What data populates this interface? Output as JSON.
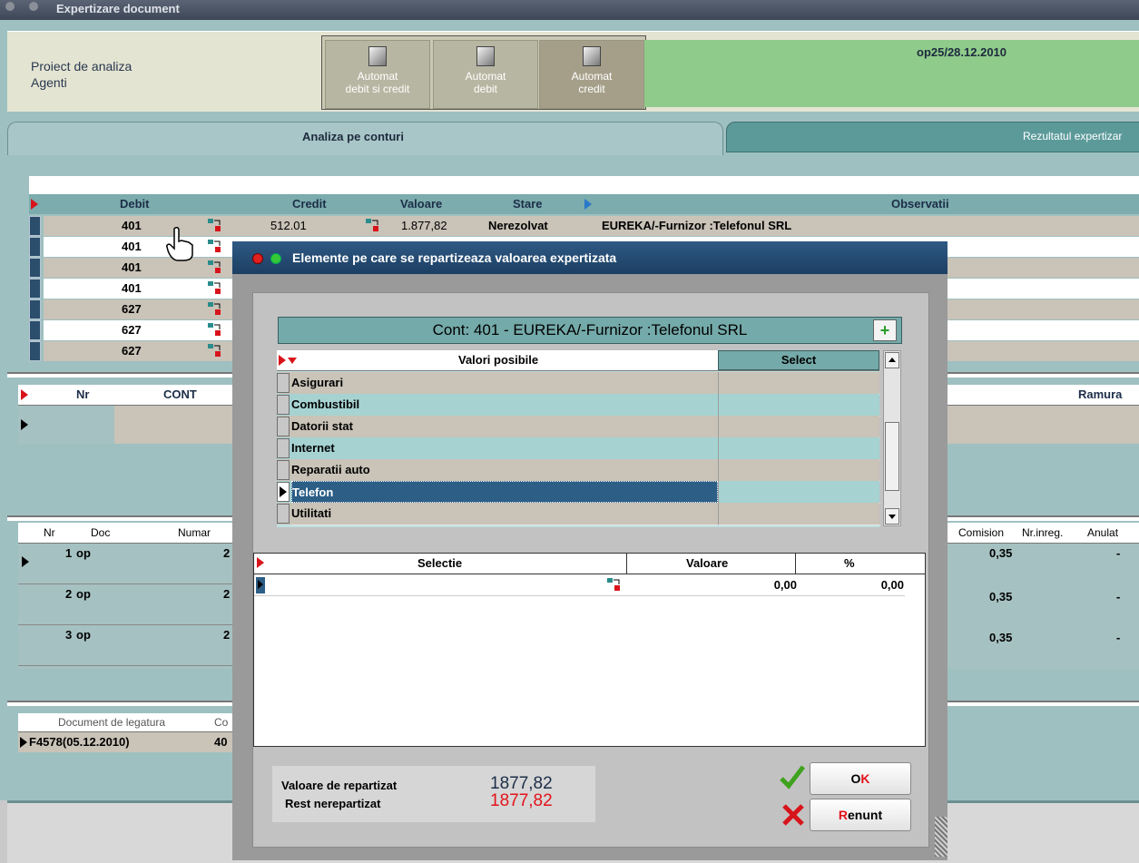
{
  "window": {
    "title": "Expertizare document"
  },
  "project": {
    "line1": "Proiect de analiza",
    "line2": "Agenti"
  },
  "auto_buttons": [
    {
      "line1": "Automat",
      "line2": "debit si credit"
    },
    {
      "line1": "Automat",
      "line2": "debit"
    },
    {
      "line1": "Automat",
      "line2": "credit"
    }
  ],
  "document_ref": "op25/28.12.2010",
  "tabs": {
    "active": "Analiza pe conturi",
    "inactive": "Rezultatul expertizar"
  },
  "accounts_grid": {
    "headers": {
      "debit": "Debit",
      "credit": "Credit",
      "valoare": "Valoare",
      "stare": "Stare",
      "observatii": "Observatii"
    },
    "rows": [
      {
        "debit": "401",
        "credit": "512.01",
        "valoare": "1.877,82",
        "stare": "Nerezolvat",
        "observatii": "EUREKA/-Furnizor :Telefonul SRL"
      },
      {
        "debit": "401"
      },
      {
        "debit": "401"
      },
      {
        "debit": "401"
      },
      {
        "debit": "627"
      },
      {
        "debit": "627"
      },
      {
        "debit": "627"
      }
    ]
  },
  "cont_grid": {
    "headers": {
      "nr": "Nr",
      "cont": "CONT",
      "ramura": "Ramura"
    }
  },
  "doc_grid": {
    "headers": {
      "nr": "Nr",
      "doc": "Doc",
      "numar": "Numar",
      "comision": "Comision",
      "nrinreg": "Nr.inreg.",
      "anulat": "Anulat"
    },
    "rows": [
      {
        "nr": "1",
        "doc": "op",
        "numar": "2",
        "comision": "0,35",
        "anulat": "-"
      },
      {
        "nr": "2",
        "doc": "op",
        "numar": "2",
        "comision": "0,35",
        "anulat": "-"
      },
      {
        "nr": "3",
        "doc": "op",
        "numar": "2",
        "comision": "0,35",
        "anulat": "-"
      }
    ]
  },
  "link_grid": {
    "headers": {
      "doc": "Document de legatura",
      "co": "Co"
    },
    "row": {
      "doc": "F4578(05.12.2010)",
      "co": "40"
    }
  },
  "dialog": {
    "title": "Elemente pe care se repartizeaza valoarea expertizata",
    "cont_label": "Cont: 401 - EUREKA/-Furnizor :Telefonul SRL",
    "values_headers": {
      "name": "Valori posibile",
      "select": "Select"
    },
    "values": [
      "Asigurari",
      "Combustibil",
      "Datorii stat",
      "Internet",
      "Reparatii auto",
      "Telefon",
      "Utilitati"
    ],
    "selected_value": "Telefon",
    "sel_headers": {
      "selectie": "Selectie",
      "valoare": "Valoare",
      "pct": "%"
    },
    "sel_row": {
      "valoare": "0,00",
      "pct": "0,00"
    },
    "summary": {
      "label1": "Valoare de repartizat",
      "value1": "1877,82",
      "label2": "Rest nerepartizat",
      "value2": "1877,82"
    },
    "ok_label": {
      "first": "O",
      "rest": "K"
    },
    "cancel_label": {
      "first": "R",
      "rest": "enunt"
    }
  },
  "colors": {
    "accent": "#2f5984",
    "green": "#8fcb8a",
    "red": "#e2131b",
    "check": "#3fa21d"
  }
}
